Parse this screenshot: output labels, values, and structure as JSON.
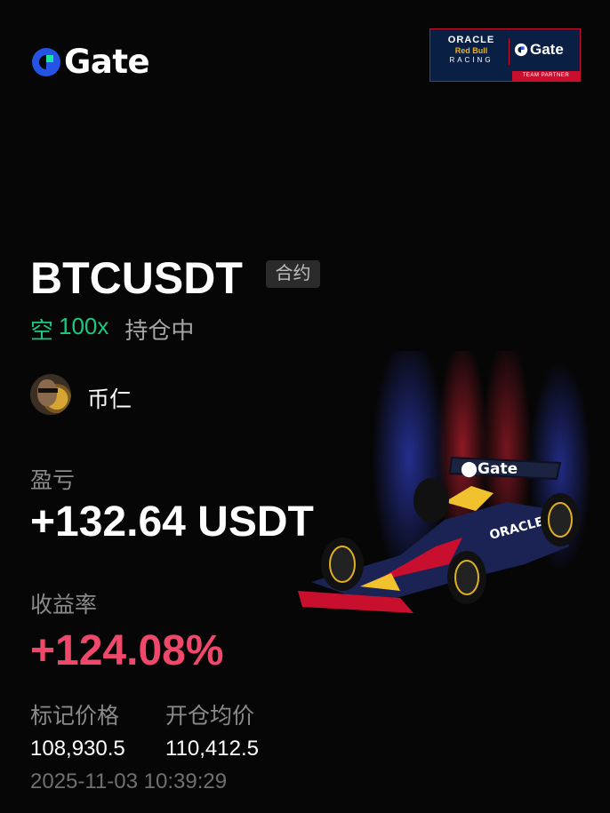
{
  "brand": {
    "name": "Gate",
    "accent": "#2354e6",
    "accent_green": "#17e6a1"
  },
  "partner_badge": {
    "line1": "ORACLE",
    "line2": "Red Bull",
    "line3": "RACING",
    "brand": "Gate",
    "footer": "TEAM PARTNER"
  },
  "position": {
    "symbol": "BTCUSDT",
    "type_tag": "合约",
    "direction": "空",
    "leverage": "100x",
    "status": "持仓中"
  },
  "user": {
    "name": "币仁"
  },
  "pnl": {
    "label": "盈亏",
    "value": "+132.64 USDT"
  },
  "roi": {
    "label": "收益率",
    "value": "+124.08%"
  },
  "prices": {
    "mark_label": "标记价格",
    "mark_value": "108,930.5",
    "entry_label": "开仓均价",
    "entry_value": "110,412.5"
  },
  "timestamp": "2025-11-03 10:39:29",
  "colors": {
    "short_green": "#1fc77e",
    "profit_red": "#f0486a",
    "muted": "#8a8a8a"
  }
}
